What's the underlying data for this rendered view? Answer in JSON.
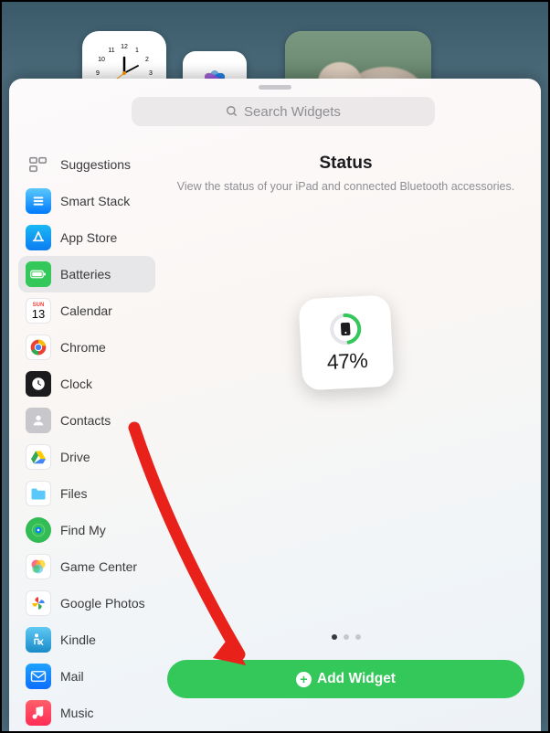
{
  "search": {
    "placeholder": "Search Widgets"
  },
  "sidebar": {
    "items": [
      {
        "name": "suggestions",
        "label": "Suggestions",
        "icon": "suggestions-icon"
      },
      {
        "name": "smart-stack",
        "label": "Smart Stack",
        "icon": "smart-stack-icon"
      },
      {
        "name": "app-store",
        "label": "App Store",
        "icon": "app-store-icon"
      },
      {
        "name": "batteries",
        "label": "Batteries",
        "icon": "batteries-icon"
      },
      {
        "name": "calendar",
        "label": "Calendar",
        "icon": "calendar-icon"
      },
      {
        "name": "chrome",
        "label": "Chrome",
        "icon": "chrome-icon"
      },
      {
        "name": "clock",
        "label": "Clock",
        "icon": "clock-icon"
      },
      {
        "name": "contacts",
        "label": "Contacts",
        "icon": "contacts-icon"
      },
      {
        "name": "drive",
        "label": "Drive",
        "icon": "drive-icon"
      },
      {
        "name": "files",
        "label": "Files",
        "icon": "files-icon"
      },
      {
        "name": "find-my",
        "label": "Find My",
        "icon": "find-my-icon"
      },
      {
        "name": "game-center",
        "label": "Game Center",
        "icon": "game-center-icon"
      },
      {
        "name": "google-photos",
        "label": "Google Photos",
        "icon": "google-photos-icon"
      },
      {
        "name": "kindle",
        "label": "Kindle",
        "icon": "kindle-icon"
      },
      {
        "name": "mail",
        "label": "Mail",
        "icon": "mail-icon"
      },
      {
        "name": "music",
        "label": "Music",
        "icon": "music-icon"
      }
    ],
    "selected_index": 3,
    "calendar_day": "13",
    "calendar_day_name": "SUN"
  },
  "preview": {
    "title": "Status",
    "subtitle": "View the status of your iPad and connected Bluetooth accessories.",
    "battery_percent": "47%",
    "battery_fraction": 0.47,
    "page_count": 3,
    "page_index": 0
  },
  "add_button": {
    "label": "Add Widget"
  }
}
